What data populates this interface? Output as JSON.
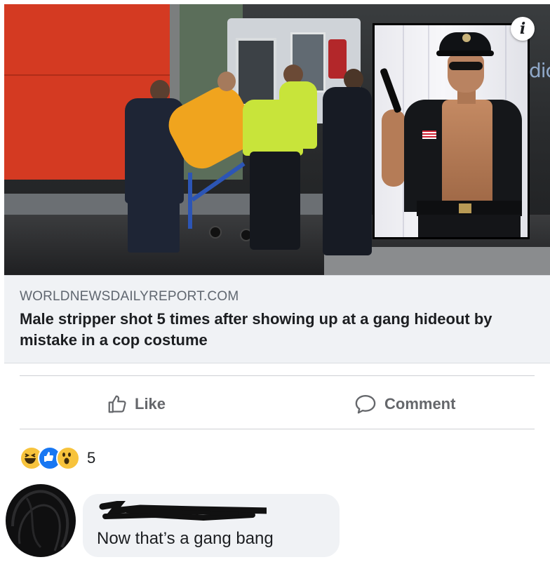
{
  "link_preview": {
    "domain": "WORLDNEWSDAILYREPORT.COM",
    "headline": "Male stripper shot 5 times after showing up at a gang hideout by mistake in a cop costume",
    "info_icon": "info-icon",
    "background_sign_text": "dic"
  },
  "actions": {
    "like_label": "Like",
    "comment_label": "Comment",
    "like_icon": "thumbs-up-icon",
    "comment_icon": "speech-bubble-icon"
  },
  "reactions": {
    "types": [
      "haha",
      "like",
      "wow"
    ],
    "count": "5"
  },
  "comment": {
    "author_name_redacted": true,
    "text": "Now that’s a gang bang"
  },
  "colors": {
    "link_meta_bg": "#f0f2f5",
    "action_text": "#65676b",
    "primary_text": "#1c1e21",
    "like_blue": "#1877f2"
  }
}
